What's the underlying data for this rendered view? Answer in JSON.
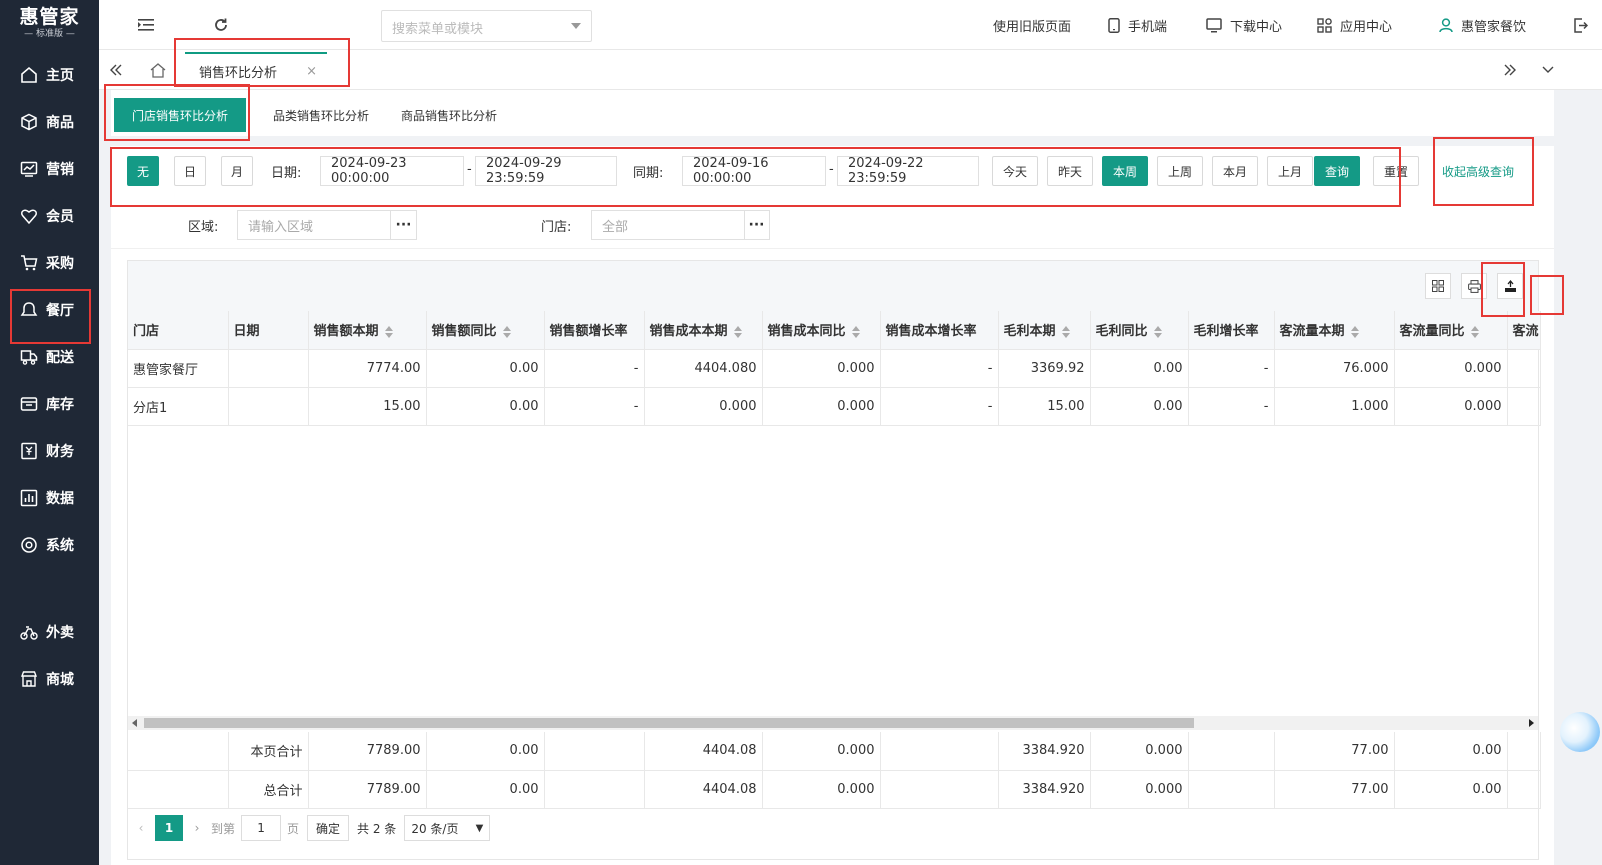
{
  "brand": {
    "name": "惠管家",
    "edition": "标准版"
  },
  "sidebar": {
    "items": [
      {
        "label": "主页",
        "icon": "home-icon"
      },
      {
        "label": "商品",
        "icon": "box-icon"
      },
      {
        "label": "营销",
        "icon": "chart-icon"
      },
      {
        "label": "会员",
        "icon": "heart-icon"
      },
      {
        "label": "采购",
        "icon": "cart-icon"
      },
      {
        "label": "餐厅",
        "icon": "bell-icon"
      },
      {
        "label": "配送",
        "icon": "truck-icon"
      },
      {
        "label": "库存",
        "icon": "warehouse-icon"
      },
      {
        "label": "财务",
        "icon": "finance-icon"
      },
      {
        "label": "数据",
        "icon": "data-icon"
      },
      {
        "label": "系统",
        "icon": "settings-icon"
      },
      {
        "label": "外卖",
        "icon": "bike-icon"
      },
      {
        "label": "商城",
        "icon": "shop-icon"
      }
    ],
    "active": "餐厅"
  },
  "topbar": {
    "search_placeholder": "搜索菜单或模块",
    "old_page": "使用旧版页面",
    "mobile": "手机端",
    "download": "下载中心",
    "apps": "应用中心",
    "user": "惠管家餐饮"
  },
  "tabs": {
    "active_tab": "销售环比分析",
    "close": "×"
  },
  "subtabs": [
    "门店销售环比分析",
    "品类销售环比分析",
    "商品销售环比分析"
  ],
  "filters": {
    "period_buttons": [
      "无",
      "日",
      "月"
    ],
    "date_label": "日期:",
    "date_start": "2024-09-23 00:00:00",
    "date_end": "2024-09-29 23:59:59",
    "same_label": "同期:",
    "same_start": "2024-09-16 00:00:00",
    "same_end": "2024-09-22 23:59:59",
    "dash": "-",
    "quick": [
      "今天",
      "昨天",
      "本周",
      "上周",
      "本月",
      "上月"
    ],
    "query": "查询",
    "reset": "重置",
    "collapse": "收起高级查询",
    "area_label": "区域:",
    "area_placeholder": "请输入区域",
    "store_label": "门店:",
    "store_placeholder": "全部",
    "dots": "···"
  },
  "table": {
    "columns": [
      "门店",
      "日期",
      "销售额本期",
      "销售额同比",
      "销售额增长率",
      "销售成本本期",
      "销售成本同比",
      "销售成本增长率",
      "毛利本期",
      "毛利同比",
      "毛利增长率",
      "客流量本期",
      "客流量同比",
      "客流"
    ],
    "rows": [
      [
        "惠管家餐厅",
        "",
        "7774.00",
        "0.00",
        "-",
        "4404.080",
        "0.000",
        "-",
        "3369.92",
        "0.00",
        "-",
        "76.000",
        "0.000",
        ""
      ],
      [
        "分店1",
        "",
        "15.00",
        "0.00",
        "-",
        "0.000",
        "0.000",
        "-",
        "15.00",
        "0.00",
        "-",
        "1.000",
        "0.000",
        ""
      ]
    ],
    "footer": [
      [
        "",
        "本页合计",
        "7789.00",
        "0.00",
        "",
        "4404.08",
        "0.000",
        "",
        "3384.920",
        "0.000",
        "",
        "77.00",
        "0.00",
        ""
      ],
      [
        "",
        "总合计",
        "7789.00",
        "0.00",
        "",
        "4404.08",
        "0.000",
        "",
        "3384.920",
        "0.000",
        "",
        "77.00",
        "0.00",
        ""
      ]
    ]
  },
  "pager": {
    "page": "1",
    "goto_label": "到第",
    "goto_value": "1",
    "page_unit": "页",
    "confirm": "确定",
    "total": "共 2 条",
    "page_size": "20 条/页"
  },
  "colors": {
    "accent": "#149a86",
    "sidebar": "#1f2836",
    "highlight": "#e53935"
  }
}
